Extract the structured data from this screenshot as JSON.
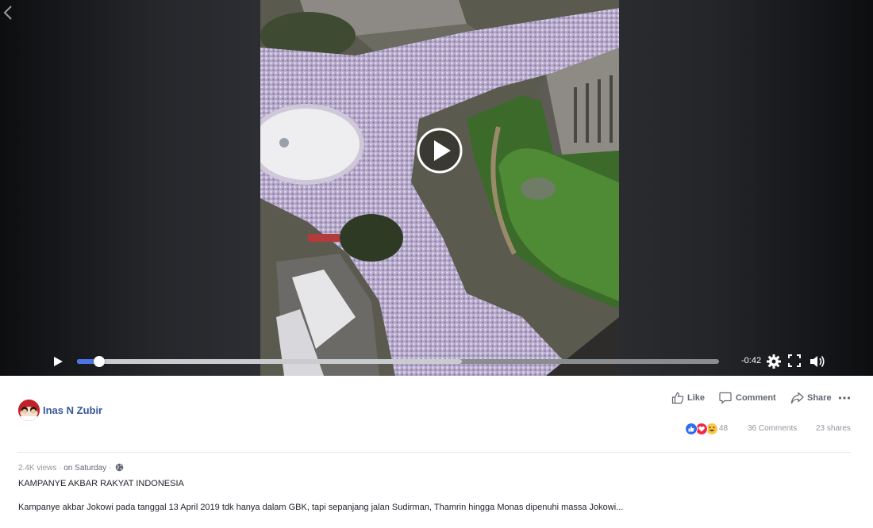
{
  "video": {
    "time_remaining": "-0:42",
    "progress": 0.035,
    "buffered": 0.6
  },
  "post": {
    "author": "Inas N Zubir",
    "views": "2.4K views",
    "separator": " · ",
    "date": "on Saturday",
    "title": "KAMPANYE AKBAR RAKYAT INDONESIA",
    "description": "Kampanye akbar Jokowi pada tanggal 13 April 2019 tdk hanya dalam GBK, tapi sepanjang jalan Sudirman, Thamrin hingga Monas dipenuhi massa Jokowi..."
  },
  "actions": {
    "like": "Like",
    "comment": "Comment",
    "share": "Share"
  },
  "stats": {
    "reactions": "48",
    "comments": "36 Comments",
    "shares": "23 shares"
  },
  "icons": {
    "back": "chevron-left-icon",
    "play_big": "play-circle-icon",
    "play": "play-icon",
    "settings": "gear-icon",
    "fullscreen": "fullscreen-icon",
    "volume": "volume-icon",
    "like": "thumbs-up-icon",
    "comment": "speech-bubble-icon",
    "share": "share-arrow-icon",
    "more": "more-dots-icon",
    "privacy": "globe-icon"
  },
  "colors": {
    "link": "#365899",
    "progress": "#4a76e8",
    "like_reaction": "#2d6cf0",
    "love_reaction": "#f0284a",
    "haha_reaction": "#f7c64a"
  }
}
